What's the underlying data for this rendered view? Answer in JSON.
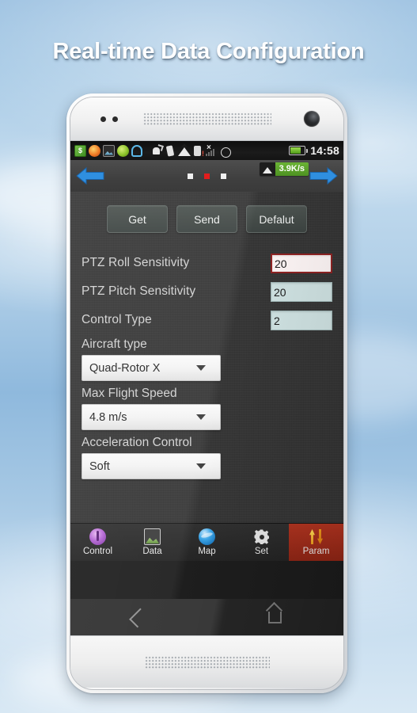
{
  "banner": {
    "title": "Real-time Data Configuration"
  },
  "phone": {
    "status_bar": {
      "notification_icons": [
        "money-icon",
        "fire-icon",
        "photo-icon",
        "leaf-icon",
        "ghost-icon"
      ],
      "system_icons": [
        "call-icon",
        "vibrate-icon",
        "wifi-icon",
        "sim-card-icon",
        "signal-no-service-icon",
        "alarm-icon",
        "battery-icon"
      ],
      "time": "14:58"
    },
    "nav_bar": {
      "prev_arrow": "arrow-left-icon",
      "next_arrow": "arrow-right-icon",
      "page_dots": 3,
      "active_dot_index": 1,
      "speed_badge": {
        "icon": "wifi-icon",
        "value": "3.9K/s",
        "color": "#5ba32a"
      }
    },
    "toolbar": {
      "get_label": "Get",
      "send_label": "Send",
      "default_label": "Defalut"
    },
    "form": {
      "rows": [
        {
          "label": "PTZ Roll Sensitivity",
          "value": "20",
          "focused": true
        },
        {
          "label": "PTZ Pitch Sensitivity",
          "value": "20",
          "focused": false
        },
        {
          "label": "Control Type",
          "value": "2",
          "focused": false
        }
      ],
      "spinners": [
        {
          "label": "Aircraft type",
          "value": "Quad-Rotor X"
        },
        {
          "label": "Max Flight Speed",
          "value": "4.8 m/s"
        },
        {
          "label": "Acceleration Control",
          "value": "Soft"
        }
      ]
    },
    "tabs": [
      {
        "label": "Control",
        "icon": "joystick-icon",
        "active": false
      },
      {
        "label": "Data",
        "icon": "photo-icon",
        "active": false
      },
      {
        "label": "Map",
        "icon": "globe-icon",
        "active": false
      },
      {
        "label": "Set",
        "icon": "gear-icon",
        "active": false
      },
      {
        "label": "Param",
        "icon": "updown-arrows-icon",
        "active": true
      }
    ],
    "soft_keys": [
      {
        "name": "back",
        "icon": "back-chevron-icon"
      },
      {
        "name": "home",
        "icon": "home-icon"
      }
    ]
  },
  "theme": {
    "accent_active_tab": "#9e2a1e",
    "focused_field_border": "#8d2020",
    "field_fill": "#cfe2e2",
    "speed_badge_green": "#5ba32a",
    "active_dot_red": "#e31d1d",
    "arrow_blue": "#2f8fe0"
  }
}
